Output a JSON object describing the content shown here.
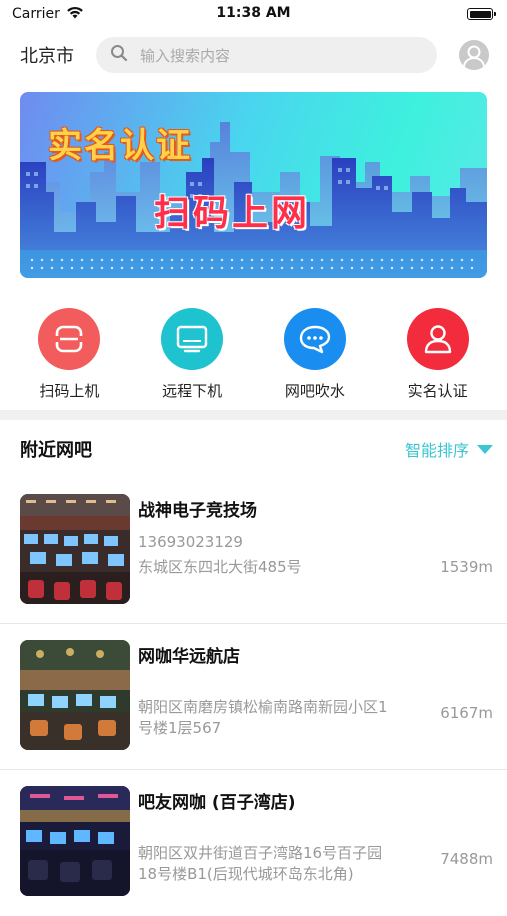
{
  "status_bar": {
    "carrier": "Carrier",
    "time": "11:38 AM"
  },
  "header": {
    "city": "北京市",
    "search_placeholder": "输入搜索内容"
  },
  "banner": {
    "line1": "实名认证",
    "line2": "扫码上网"
  },
  "actions": [
    {
      "label": "扫码上机",
      "color": "#f25c5c",
      "icon": "scan-icon"
    },
    {
      "label": "远程下机",
      "color": "#1fc3cf",
      "icon": "monitor-icon"
    },
    {
      "label": "网吧吹水",
      "color": "#1a8ef0",
      "icon": "chat-icon"
    },
    {
      "label": "实名认证",
      "color": "#f22c3c",
      "icon": "user-icon"
    }
  ],
  "nearby": {
    "title": "附近网吧",
    "sort_label": "智能排序"
  },
  "cafes": [
    {
      "name": "战神电子竞技场",
      "phone": "13693023129",
      "address": "东城区东四北大街485号",
      "distance": "1539m"
    },
    {
      "name": "网咖华远航店",
      "phone": "",
      "address": "朝阳区南磨房镇松榆南路南新园小区1号楼1层567",
      "distance": "6167m"
    },
    {
      "name": "吧友网咖 (百子湾店)",
      "phone": "",
      "address": "朝阳区双井街道百子湾路16号百子园18号楼B1(后现代城环岛东北角)",
      "distance": "7488m"
    }
  ],
  "colors": {
    "accent": "#3cc6d2"
  }
}
